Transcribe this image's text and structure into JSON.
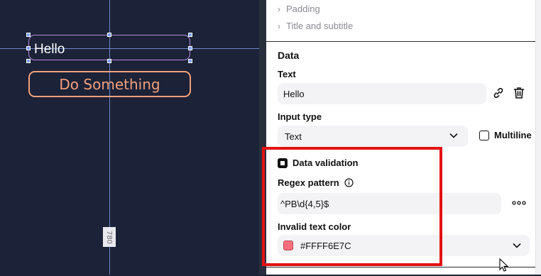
{
  "canvas": {
    "hello_text": "Hello",
    "button_label": "Do Something",
    "ruler_value": "780"
  },
  "panel": {
    "collapsed_sections": [
      {
        "label": "Padding"
      },
      {
        "label": "Title and subtitle"
      }
    ],
    "data_section": {
      "title": "Data",
      "text_label": "Text",
      "text_value": "Hello",
      "input_type_label": "Input type",
      "input_type_value": "Text",
      "multiline_label": "Multiline",
      "data_validation_label": "Data validation",
      "regex_label": "Regex pattern",
      "regex_value": "^PB\\d{4,5}$",
      "invalid_color_label": "Invalid text color",
      "invalid_color_value": "#FFFF6E7C"
    }
  },
  "colors": {
    "canvas_bg": "#1c2237",
    "button_outline": "#f2a07a",
    "invalid_swatch": "#FF6E7C",
    "highlight": "#e31212"
  }
}
